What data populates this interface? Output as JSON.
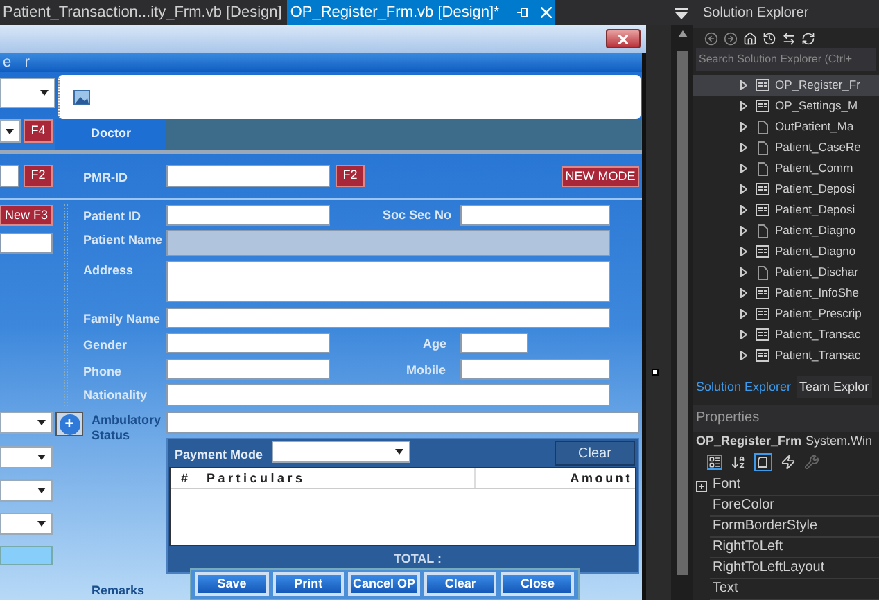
{
  "tabs": [
    {
      "label": "Patient_Transaction...ity_Frm.vb [Design]",
      "selected": false
    },
    {
      "label": "OP_Register_Frm.vb [Design]*",
      "selected": true
    }
  ],
  "form": {
    "heading": "e r",
    "doctor_tab": "Doctor",
    "f4_button": "F4",
    "f2_buttons": [
      "F2",
      "F2"
    ],
    "new_button": "New F3",
    "pmr_label": "PMR-ID",
    "mode_button": "NEW MODE",
    "patient_fields": [
      {
        "label": "Patient ID",
        "disabled": false
      },
      {
        "label": "Soc Sec No",
        "disabled": false
      },
      {
        "label": "Patient Name",
        "disabled": true
      },
      {
        "label": "Address",
        "disabled": false
      },
      {
        "label": "Family Name",
        "disabled": false
      },
      {
        "label": "Gender",
        "disabled": false
      },
      {
        "label": "Age",
        "disabled": false
      },
      {
        "label": "Phone",
        "disabled": false
      },
      {
        "label": "Mobile",
        "disabled": false
      },
      {
        "label": "Nationality",
        "disabled": false
      }
    ],
    "ambulatory_label": "Ambulatory Status",
    "plus_button": "+",
    "payment": {
      "label": "Payment Mode",
      "clear_button": "Clear",
      "columns": [
        "#",
        "Particulars",
        "Amount"
      ],
      "total": "TOTAL :"
    },
    "remarks_label": "Remarks",
    "actions": [
      "Save",
      "Print",
      "Cancel OP",
      "Clear",
      "Close"
    ]
  },
  "solution_explorer": {
    "title": "Solution Explorer",
    "search": {
      "placeholder": "Search Solution Explorer (Ctrl+"
    },
    "items": [
      {
        "label": "OP_Register_Fr",
        "kind": "form",
        "selected": true
      },
      {
        "label": "OP_Settings_M",
        "kind": "form",
        "selected": false
      },
      {
        "label": "OutPatient_Ma",
        "kind": "file",
        "selected": false
      },
      {
        "label": "Patient_CaseRe",
        "kind": "file",
        "selected": false
      },
      {
        "label": "Patient_Comm",
        "kind": "file",
        "selected": false
      },
      {
        "label": "Patient_Deposi",
        "kind": "form",
        "selected": false
      },
      {
        "label": "Patient_Deposi",
        "kind": "form",
        "selected": false
      },
      {
        "label": "Patient_Diagno",
        "kind": "file",
        "selected": false
      },
      {
        "label": "Patient_Diagno",
        "kind": "form",
        "selected": false
      },
      {
        "label": "Patient_Dischar",
        "kind": "file",
        "selected": false
      },
      {
        "label": "Patient_InfoShe",
        "kind": "form",
        "selected": false
      },
      {
        "label": "Patient_Prescrip",
        "kind": "form",
        "selected": false
      },
      {
        "label": "Patient_Transac",
        "kind": "form",
        "selected": false
      },
      {
        "label": "Patient_Transac",
        "kind": "form",
        "selected": false
      }
    ],
    "tabs": [
      {
        "label": "Solution Explorer",
        "selected": true
      },
      {
        "label": "Team Explor",
        "selected": false
      }
    ]
  },
  "properties": {
    "title": "Properties",
    "object": "OP_Register_Frm",
    "type": "System.Win",
    "rows": [
      {
        "label": "Font",
        "expandable": true
      },
      {
        "label": "ForeColor",
        "expandable": false
      },
      {
        "label": "FormBorderStyle",
        "expandable": false
      },
      {
        "label": "RightToLeft",
        "expandable": false
      },
      {
        "label": "RightToLeftLayout",
        "expandable": false
      },
      {
        "label": "Text",
        "expandable": false
      }
    ]
  }
}
